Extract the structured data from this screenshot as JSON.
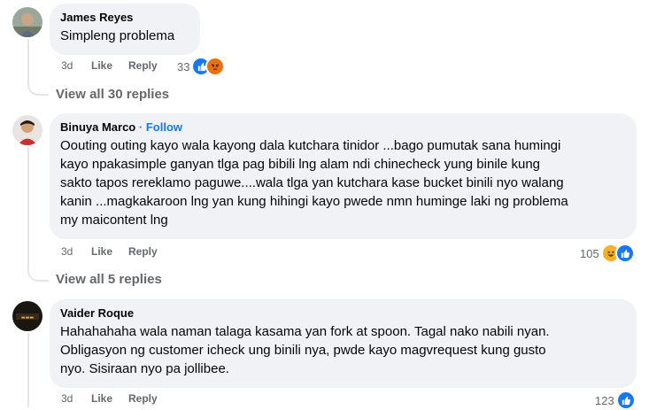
{
  "comments": [
    {
      "author": "James Reyes",
      "text": "Simpleng problema",
      "time": "3d",
      "like_label": "Like",
      "reply_label": "Reply",
      "reaction_count": "33",
      "reactions": [
        "like-icon",
        "angry-icon"
      ],
      "view_replies": "View all 30 replies"
    },
    {
      "author": "Binuya Marco",
      "separator": "·",
      "follow_label": "Follow",
      "text_lines": [
        "Oouting outing kayo wala kayong dala kutchara tinidor ...bago pumutak sana humingi",
        "kayo npakasimple ganyan tlga pag bibili lng alam ndi chinecheck yung binile kung",
        "sakto tapos rereklamo paguwe....wala tlga yan kutchara kase bucket binili nyo walang",
        "kanin ...magkakaroon lng yan kung hihingi kayo pwede nmn huminge laki ng problema",
        "my maicontent lng"
      ],
      "time": "3d",
      "like_label": "Like",
      "reply_label": "Reply",
      "reaction_count": "105",
      "reactions": [
        "haha-icon",
        "like-icon"
      ],
      "view_replies": "View all 5 replies"
    },
    {
      "author": "Vaider Roque",
      "text_lines": [
        "Hahahahaha wala naman talaga kasama yan fork at spoon. Tagal nako nabili nyan.",
        "Obligasyon ng customer icheck ung binili nya, pwde kayo magvrequest kung gusto",
        "nyo. Sisiraan nyo pa jollibee."
      ],
      "time": "3d",
      "like_label": "Like",
      "reply_label": "Reply",
      "reaction_count": "123",
      "reactions": [
        "like-icon"
      ]
    }
  ],
  "colors": {
    "bubble": "#f0f2f5",
    "link": "#1877f2",
    "muted": "#65676b",
    "like": "#1877f2",
    "angry": "#e9710f",
    "haha": "#f7b125"
  }
}
